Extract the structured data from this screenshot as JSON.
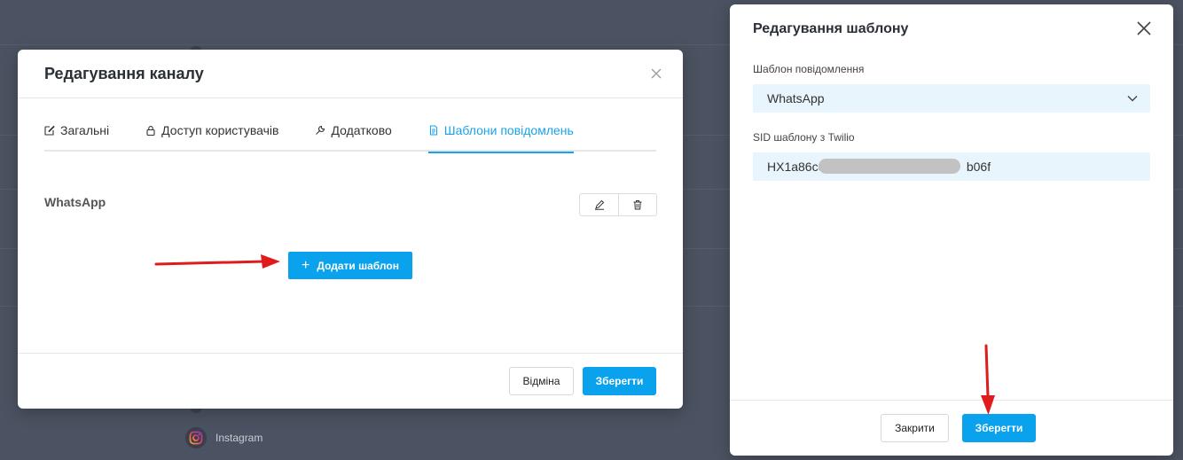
{
  "background": {
    "list_item_label": "Instagram"
  },
  "channel_modal": {
    "title": "Редагування каналу",
    "tabs": [
      {
        "label": "Загальні",
        "icon": "edit-icon",
        "active": false
      },
      {
        "label": "Доступ користувачів",
        "icon": "lock-icon",
        "active": false
      },
      {
        "label": "Додатково",
        "icon": "wrench-icon",
        "active": false
      },
      {
        "label": "Шаблони повідомлень",
        "icon": "document-icon",
        "active": true
      }
    ],
    "template_item": {
      "name": "WhatsApp",
      "edit_icon": "pencil-icon",
      "delete_icon": "trash-icon"
    },
    "add_template_label": "Додати шаблон",
    "cancel_label": "Відміна",
    "save_label": "Зберегти"
  },
  "template_modal": {
    "title": "Редагування шаблону",
    "message_template_label": "Шаблон повідомлення",
    "message_template_value": "WhatsApp",
    "sid_label": "SID шаблону з Twilio",
    "sid_value": "HX1a86ce                                         b06f",
    "close_label": "Закрити",
    "save_label": "Зберегти"
  },
  "colors": {
    "accent": "#0aa2ec",
    "annotation": "#e01b1b",
    "input_bg": "#e8f5fd",
    "overlay": "#4b5261"
  }
}
